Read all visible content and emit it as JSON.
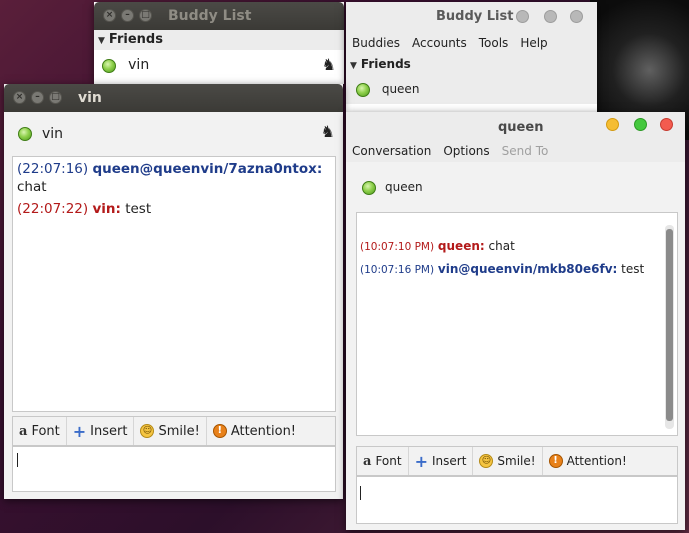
{
  "buddy_list_back": {
    "title": "Buddy List",
    "group": "Friends",
    "buddy": "vin"
  },
  "buddy_list_front": {
    "title": "Buddy List",
    "menu": [
      "Buddies",
      "Accounts",
      "Tools",
      "Help"
    ],
    "group": "Friends",
    "buddy": "queen"
  },
  "conv_vin": {
    "title": "vin",
    "contact": "vin",
    "messages": [
      {
        "time": "(22:07:16)",
        "sender": "queen@queenvin/7azna0ntox:",
        "text": "chat",
        "style": "blue"
      },
      {
        "time": "(22:07:22)",
        "sender": "vin:",
        "text": "test",
        "style": "red"
      }
    ],
    "toolbar": {
      "font": "Font",
      "insert": "Insert",
      "smile": "Smile!",
      "attention": "Attention!"
    }
  },
  "conv_queen": {
    "title": "queen",
    "menu": [
      "Conversation",
      "Options",
      "Send To"
    ],
    "contact": "queen",
    "messages": [
      {
        "time": "(10:07:10 PM)",
        "sender": "queen:",
        "text": "chat",
        "style": "red"
      },
      {
        "time": "(10:07:16 PM)",
        "sender": "vin@queenvin/mkb80e6fv:",
        "text": "test",
        "style": "blue"
      }
    ],
    "toolbar": {
      "font": "Font",
      "insert": "Insert",
      "smile": "Smile!",
      "attention": "Attention!"
    }
  },
  "colors": {
    "local_name": "#b31a1a",
    "remote_name": "#1f3c8a",
    "title_dark": "#3b3a36",
    "close_light": "#f35b4f",
    "min_light": "#f5bd33",
    "max_light": "#45c83e"
  },
  "icons": [
    "close-icon",
    "minimize-icon",
    "maximize-icon",
    "status-available-icon",
    "buddy-icon",
    "triangle-down-icon",
    "font-icon",
    "insert-icon",
    "smile-icon",
    "attention-icon"
  ]
}
